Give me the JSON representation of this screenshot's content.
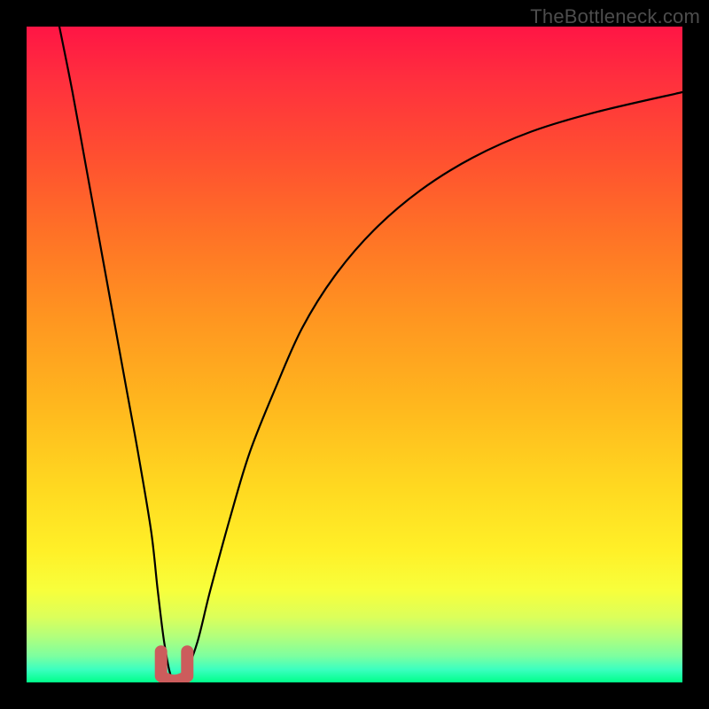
{
  "watermark": "TheBottleneck.com",
  "chart_data": {
    "type": "line",
    "title": "",
    "xlabel": "",
    "ylabel": "",
    "xlim": [
      0,
      100
    ],
    "ylim": [
      0,
      100
    ],
    "grid": false,
    "series": [
      {
        "name": "bottleneck-curve",
        "x": [
          5,
          7,
          9,
          11,
          13,
          15,
          17,
          19,
          20,
          21,
          22,
          23,
          24,
          26,
          28,
          31,
          34,
          38,
          42,
          47,
          53,
          60,
          68,
          77,
          87,
          100
        ],
        "y": [
          100,
          90,
          79,
          68,
          57,
          46,
          35,
          23,
          14,
          6,
          1,
          0.5,
          1,
          6,
          14,
          25,
          35,
          45,
          54,
          62,
          69,
          75,
          80,
          84,
          87,
          90
        ]
      }
    ],
    "marker": {
      "name": "trough-marker",
      "x": 22.5,
      "y": 0.7,
      "width": 4,
      "height": 4,
      "color": "#cc5c5c"
    },
    "gradient_colormap": {
      "top": "#ff1545",
      "upper_mid": "#ff9720",
      "mid": "#fff028",
      "lower_mid": "#b2ff7c",
      "bottom": "#00ff8a"
    }
  }
}
